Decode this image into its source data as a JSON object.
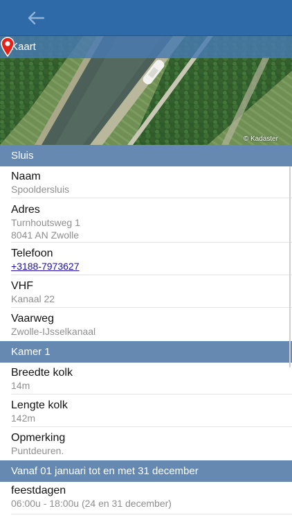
{
  "header": {
    "back_icon": "arrow-left-icon"
  },
  "map": {
    "title": "Kaart",
    "attribution": "© Kadaster",
    "pin_icon": "map-pin-icon",
    "pin_color": "#e2231a"
  },
  "sections": {
    "sluis": {
      "title": "Sluis",
      "rows": [
        {
          "label": "Naam",
          "value": "Spooldersluis"
        },
        {
          "label": "Adres",
          "value_line1": "Turnhoutsweg 1",
          "value_line2": "8041 AN Zwolle"
        },
        {
          "label": "Telefoon",
          "value": "+3188-7973627"
        },
        {
          "label": "VHF",
          "value": "Kanaal 22"
        },
        {
          "label": "Vaarweg",
          "value": "Zwolle-IJsselkanaal"
        }
      ]
    },
    "kamer": {
      "title": "Kamer 1",
      "rows": [
        {
          "label": "Breedte kolk",
          "value": "14m"
        },
        {
          "label": "Lengte kolk",
          "value": "142m"
        },
        {
          "label": "Opmerking",
          "value": "Puntdeuren."
        }
      ]
    },
    "period": {
      "title": "Vanaf 01 januari tot en met 31 december",
      "rows": [
        {
          "label": "feestdagen",
          "value": "06:00u - 18:00u (24 en 31 december)"
        }
      ]
    }
  },
  "colors": {
    "topbar": "#2f6aa8",
    "section_header": "#6689b2",
    "link": "#1a0dab"
  }
}
